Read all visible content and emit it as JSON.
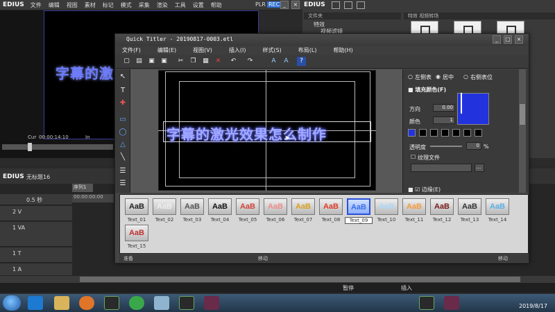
{
  "main_menu": {
    "brand": "EDIUS",
    "items": [
      "文件",
      "编辑",
      "视图",
      "素材",
      "标记",
      "模式",
      "采集",
      "渲染",
      "工具",
      "设置",
      "帮助"
    ],
    "plr": "PLR",
    "rec": "REC"
  },
  "player": {
    "preview_text": "字幕的激",
    "timecode_label": "Cur",
    "timecode": "00:00:14:10",
    "in_label": "In"
  },
  "bin": {
    "brand": "EDIUS",
    "tree_header": "文件夹",
    "tree_items": [
      "特效",
      "视频滤镜"
    ],
    "clip_header": "特效 视频转场"
  },
  "timeline": {
    "brand": "EDIUS",
    "sequence_name": "无标题16",
    "sequence_tab": "序列1",
    "ruler_tc": "00:00:00:00",
    "zoom": "0.5 秒",
    "tracks": [
      "2 V",
      "1 VA",
      "1 T",
      "1 A"
    ],
    "status_pause": "暂停",
    "status_insert": "插入"
  },
  "taskbar": {
    "clock": "2019/8/17"
  },
  "quick_titler": {
    "title": "Quick Titler - 20190817-0003.etl",
    "menu": [
      "文件(F)",
      "编辑(E)",
      "视图(V)",
      "插入(I)",
      "样式(S)",
      "布局(L)",
      "帮助(H)"
    ],
    "title_text": "字幕的激光效果怎么制作",
    "props": {
      "align_left": "左侧表",
      "align_center": "居中",
      "align_right": "右侧表位",
      "fill_color_label": "填充颜色(F)",
      "direction_label": "方向",
      "direction_value": "0.00",
      "colors_label": "颜色",
      "colors_value": "1",
      "opacity_label": "透明度",
      "opacity_value": "0",
      "opacity_unit": "%",
      "texture_label": "纹理文件",
      "browse": "...",
      "edge_label": "边缘(E)",
      "fill_color": "#2233dd"
    },
    "gallery": [
      {
        "label": "Text_01",
        "color": "#222222"
      },
      {
        "label": "Text_02",
        "color": "#eeeeee"
      },
      {
        "label": "Text_03",
        "color": "#555555"
      },
      {
        "label": "Text_04",
        "color": "#111111"
      },
      {
        "label": "Text_05",
        "color": "#d0443a"
      },
      {
        "label": "Text_06",
        "color": "#f08c8c"
      },
      {
        "label": "Text_07",
        "color": "#d9a020"
      },
      {
        "label": "Text_08",
        "color": "#e03a2a"
      },
      {
        "label": "Text_09",
        "color": "#3a6ee8"
      },
      {
        "label": "Text_10",
        "color": "#a8d8ff"
      },
      {
        "label": "Text_11",
        "color": "#f59a3a"
      },
      {
        "label": "Text_12",
        "color": "#7a1a1a"
      },
      {
        "label": "Text_13",
        "color": "#333333"
      },
      {
        "label": "Text_14",
        "color": "#5ab0e8"
      },
      {
        "label": "Text_15",
        "color": "#c03030"
      }
    ],
    "status_left": "准备",
    "status_mid": "移动",
    "status_right": "移动",
    "gallery_text": "AaB"
  }
}
